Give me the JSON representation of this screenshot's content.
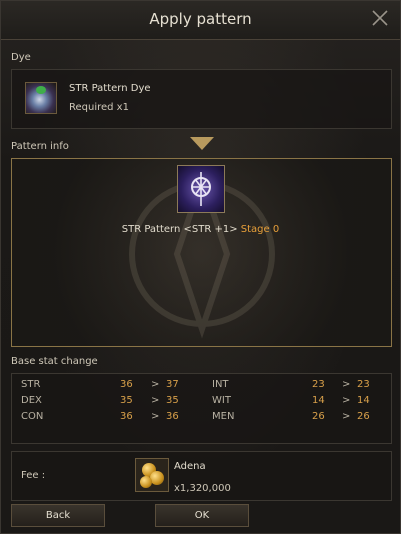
{
  "window": {
    "title": "Apply pattern"
  },
  "dye": {
    "section_label": "Dye",
    "item_name": "STR Pattern Dye",
    "requirement": "Required x1"
  },
  "pattern": {
    "section_label": "Pattern info",
    "name": "STR Pattern <STR +1>",
    "stage": "Stage 0"
  },
  "base_stats": {
    "section_label": "Base stat change",
    "left": [
      {
        "stat": "STR",
        "from": "36",
        "to": "37"
      },
      {
        "stat": "DEX",
        "from": "35",
        "to": "35"
      },
      {
        "stat": "CON",
        "from": "36",
        "to": "36"
      }
    ],
    "right": [
      {
        "stat": "INT",
        "from": "23",
        "to": "23"
      },
      {
        "stat": "WIT",
        "from": "14",
        "to": "14"
      },
      {
        "stat": "MEN",
        "from": "26",
        "to": "26"
      }
    ],
    "arrow": ">"
  },
  "fee": {
    "label": "Fee :",
    "currency": "Adena",
    "amount": "x1,320,000"
  },
  "buttons": {
    "back": "Back",
    "ok": "OK"
  },
  "colors": {
    "accent_gold": "#e8a03a",
    "panel_border": "#8a7446"
  },
  "icons": {
    "close": "close-icon",
    "dye": "dye-bottle-icon",
    "arrow": "down-arrow-icon",
    "pattern": "pattern-emblem-icon",
    "adena": "adena-coins-icon"
  }
}
